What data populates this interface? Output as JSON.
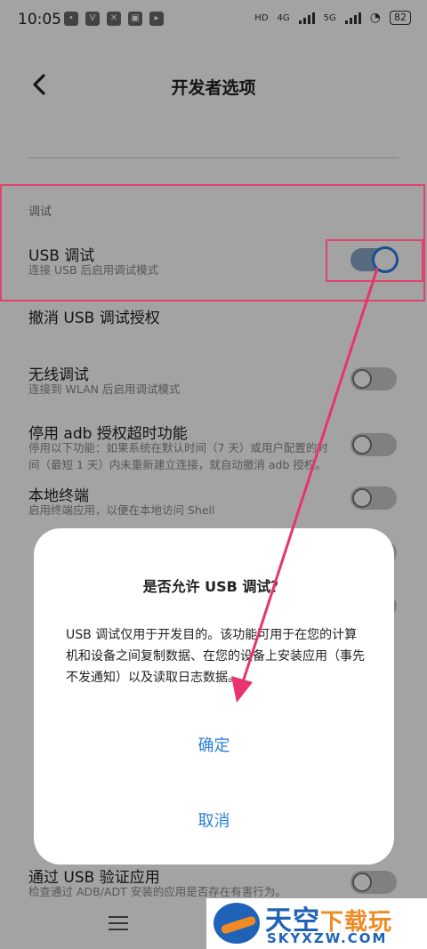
{
  "status_bar": {
    "time": "10:05",
    "right_labels": {
      "hd": "HD",
      "net1": "4G",
      "net2": "5G"
    },
    "battery": "82"
  },
  "app_bar": {
    "title": "开发者选项"
  },
  "section_debug": {
    "label": "调试"
  },
  "settings": [
    {
      "title": "USB 调试",
      "subtitle": "连接 USB 后启用调试模式",
      "toggle": "on"
    },
    {
      "title": "撤消 USB 调试授权",
      "subtitle": ""
    },
    {
      "title": "无线调试",
      "subtitle": "连接到 WLAN 后启用调试模式",
      "toggle": "off"
    },
    {
      "title": "停用 adb 授权超时功能",
      "subtitle": "停用以下功能：如果系统在默认时间（7 天）或用户配置的时间（最短 1 天）内未重新建立连接，就自动撤消 adb 授权。",
      "toggle": "off"
    },
    {
      "title": "本地终端",
      "subtitle": "启用终端应用，以便在本地访问 Shell",
      "toggle": "off"
    },
    {
      "title": "通过 USB 验证应用",
      "subtitle": "检查通过 ADB/ADT 安装的应用是否存在有害行为。",
      "toggle": "off"
    }
  ],
  "dialog": {
    "title": "是否允许 USB 调试？",
    "message": "USB 调试仅用于开发目的。该功能可用于在您的计算机和设备之间复制数据、在您的设备上安装应用（事先不发通知）以及读取日志数据。",
    "confirm": "确定",
    "cancel": "取消"
  },
  "watermark": {
    "cn_main": "天空",
    "cn_accent": "下载玩",
    "en": "SKYXZW.COM"
  },
  "colors": {
    "accent": "#2a7fd4",
    "highlight": "#e0446a",
    "arrow": "#e8336e"
  }
}
